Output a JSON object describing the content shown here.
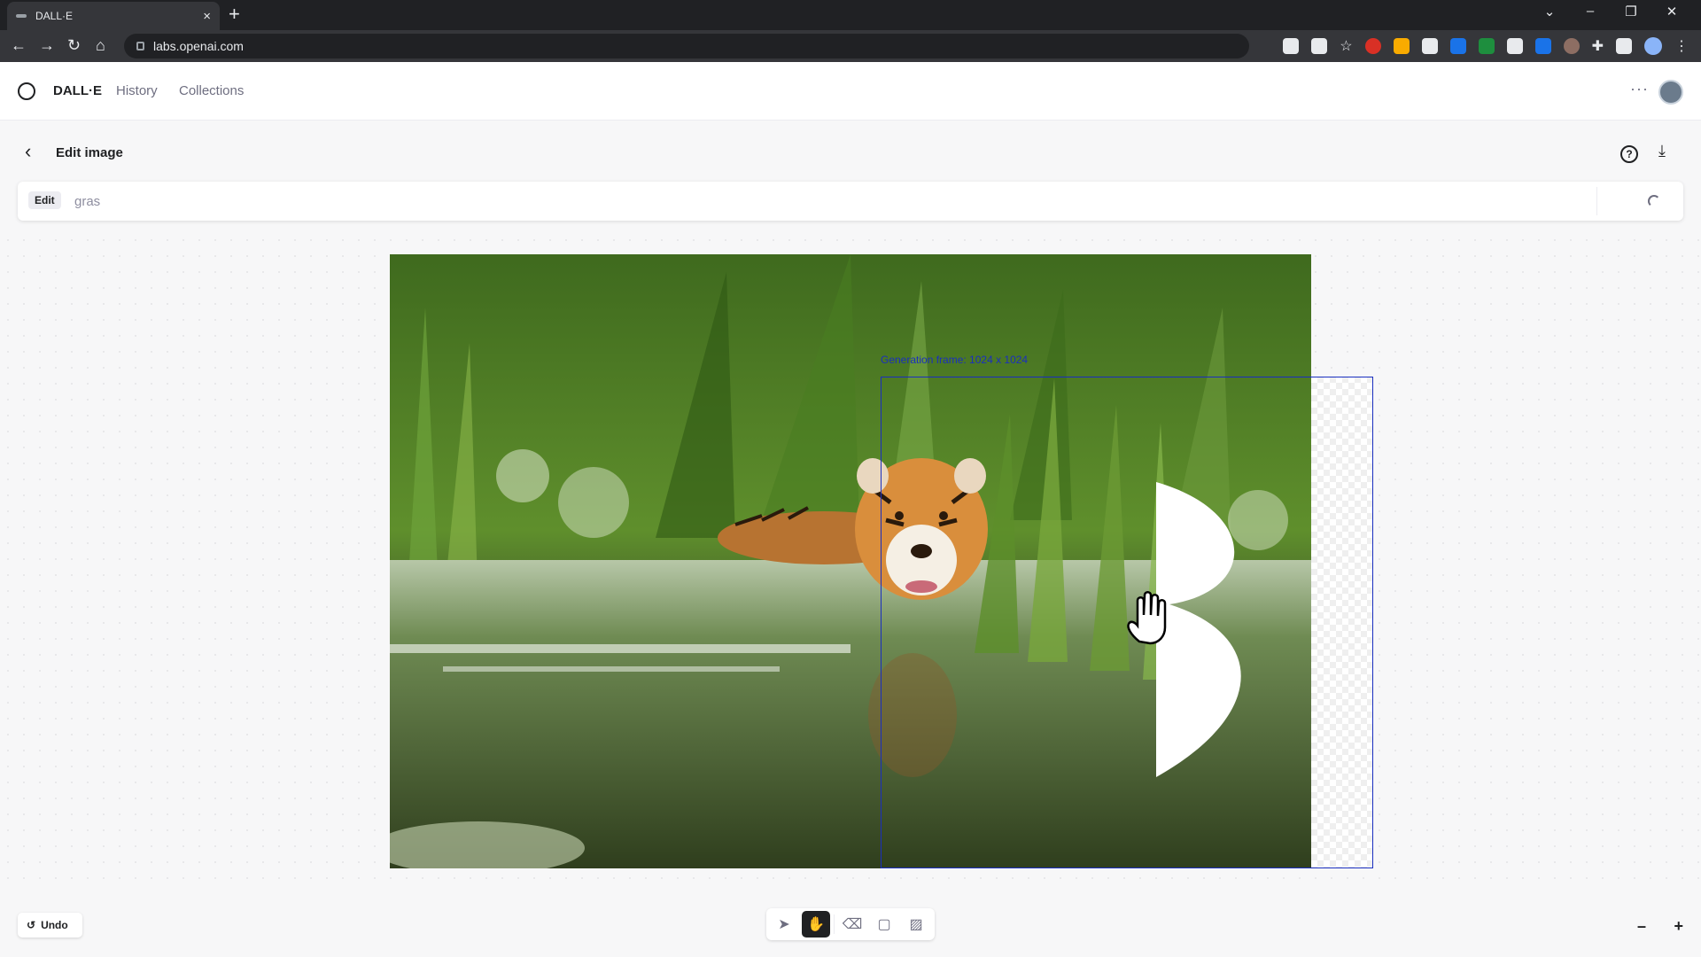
{
  "browser": {
    "tab_title": "DALL·E",
    "tab_close": "×",
    "new_tab": "+",
    "url": "labs.openai.com",
    "window_controls": [
      "⌄",
      "–",
      "❐",
      "✕"
    ],
    "nav": {
      "back": "←",
      "forward": "→",
      "reload": "↻",
      "home": "⌂"
    },
    "extension_icons": [
      "download-icon",
      "share-icon",
      "star-icon",
      "adblock-icon",
      "sticky-notes-icon",
      "misc-ext-icon",
      "translate-icon",
      "download-green-icon",
      "camera-icon",
      "color-wheel-icon",
      "extensions-icon",
      "sidebar-icon",
      "profile-icon",
      "menu-icon"
    ]
  },
  "app": {
    "brand": "DALL·E",
    "nav": {
      "history": "History",
      "collections": "Collections"
    },
    "more": "···"
  },
  "edit": {
    "title": "Edit image",
    "back": "‹",
    "help": "?",
    "download": "⤓"
  },
  "prompt": {
    "chip": "Edit",
    "placeholder": "gras",
    "value": ""
  },
  "canvas": {
    "frame_label": "Generation frame: 1024 x 1024",
    "image_subject": "tiger in water among tall grass"
  },
  "tools": {
    "select": "select-tool",
    "pan": "pan-tool",
    "eraser": "eraser-tool",
    "add_frame": "add-frame-tool",
    "upload": "upload-image-tool",
    "active": "pan"
  },
  "bottom": {
    "undo": "Undo",
    "zoom_out": "–",
    "zoom_in": "+"
  },
  "colors": {
    "frame_accent": "#1a2fbf",
    "active_tool": "#202123",
    "brand_text": "#202123"
  }
}
